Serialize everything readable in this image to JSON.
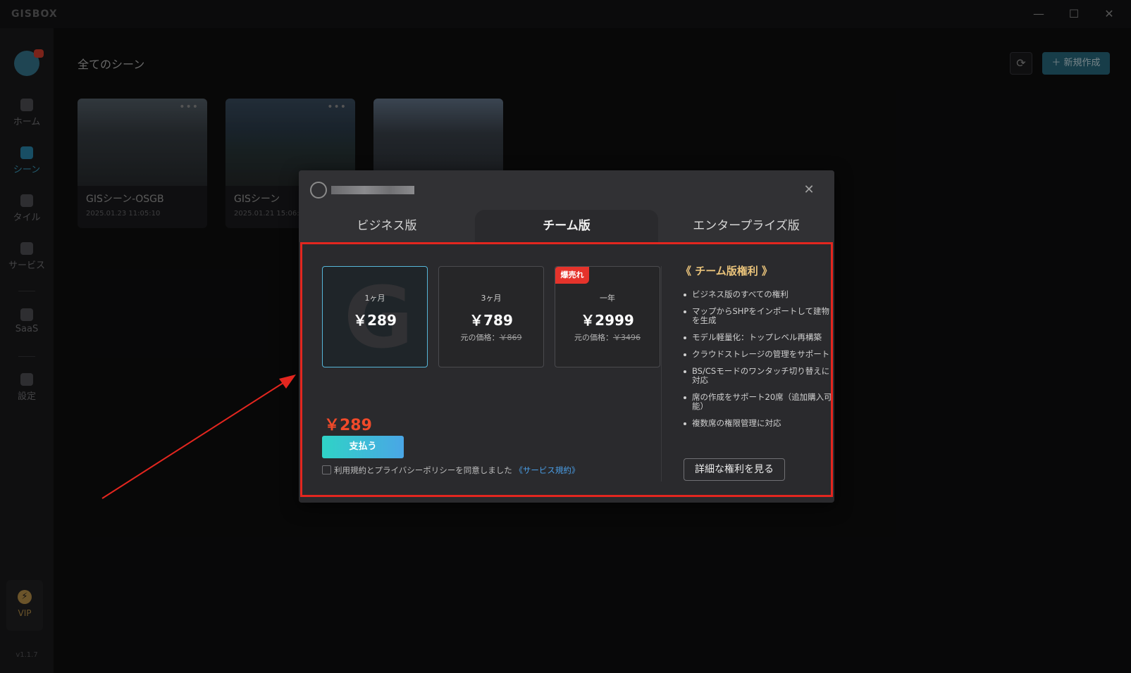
{
  "app": {
    "logo_text": "GISBOX",
    "version": "v1.1.7"
  },
  "window_controls": {
    "minimize": "—",
    "maximize": "☐",
    "close": "✕"
  },
  "sidebar": {
    "items": [
      {
        "label": "ホーム",
        "icon": "home-icon"
      },
      {
        "label": "シーン",
        "icon": "scene-cube-icon",
        "active": true
      },
      {
        "label": "タイル",
        "icon": "tile-icon"
      },
      {
        "label": "サービス",
        "icon": "service-icon"
      },
      {
        "label": "SaaS",
        "icon": "lock-icon"
      },
      {
        "label": "設定",
        "icon": "settings-gear-icon"
      }
    ],
    "vip_label": "VIP"
  },
  "header": {
    "title": "全てのシーン",
    "refresh_icon": "⟳",
    "new_button_label": "＋ 新規作成"
  },
  "scenes": [
    {
      "name": "GISシーン-OSGB",
      "date": "2025.01.23 11:05:10"
    },
    {
      "name": "GISシーン",
      "date": "2025.01.21 15:06:56"
    },
    {
      "name": "",
      "date": ""
    }
  ],
  "dialog": {
    "close_icon": "✕",
    "tabs": [
      {
        "label": "ビジネス版"
      },
      {
        "label": "チーム版",
        "active": true
      },
      {
        "label": "エンタープライズ版"
      }
    ],
    "plans": [
      {
        "period": "1ヶ月",
        "price": "￥289",
        "original_label": "",
        "original_price": "",
        "badge": "",
        "selected": true
      },
      {
        "period": "3ヶ月",
        "price": "￥789",
        "original_label": "元の価格：",
        "original_price": "￥869",
        "badge": ""
      },
      {
        "period": "一年",
        "price": "￥2999",
        "original_label": "元の価格：",
        "original_price": "￥3496",
        "badge": "爆売れ"
      }
    ],
    "total_price": "￥289",
    "pay_button": "支払う",
    "agreement_text": "利用規約とプライバシーポリシーを同意しました",
    "agreement_link": "《サービス規約》",
    "benefits_title": "《 チーム版権利 》",
    "benefits": [
      "ビジネス版のすべての権利",
      "マップからSHPをインポートして建物を生成",
      "モデル軽量化：トップレベル再構築",
      "クラウドストレージの管理をサポート",
      "BS/CSモードのワンタッチ切り替えに対応",
      "席の作成をサポート20席（追加購入可能）",
      "複数席の権限管理に対応"
    ],
    "detail_button": "詳細な権利を見る"
  },
  "colors": {
    "accent": "#2b6f86",
    "highlight_frame": "#e3261f",
    "price": "#f04a2a",
    "gold": "#e8c27a"
  }
}
